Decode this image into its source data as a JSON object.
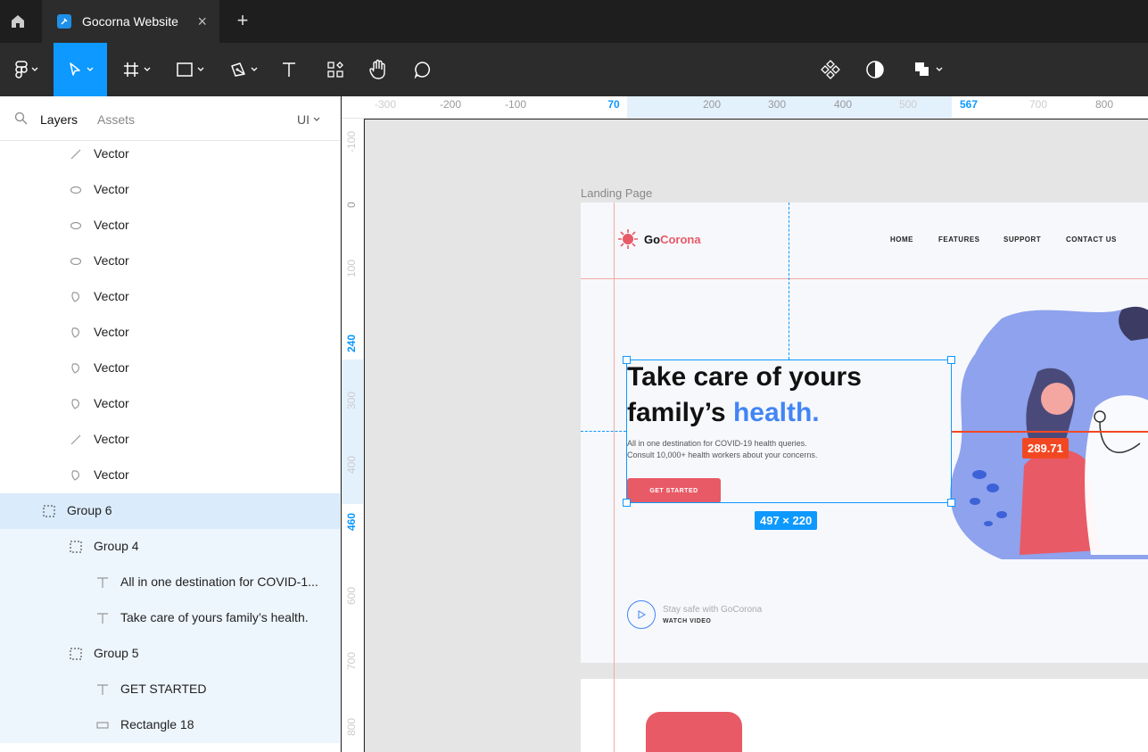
{
  "app": {
    "tab_title": "Gocorna Website"
  },
  "toolbar": {
    "tools": [
      "figma-menu",
      "move",
      "frame",
      "shape",
      "pen",
      "text",
      "resources",
      "hand",
      "comment"
    ],
    "right_tools": [
      "components",
      "mask",
      "boolean"
    ]
  },
  "panel": {
    "tab_layers": "Layers",
    "tab_assets": "Assets",
    "page_label": "UI"
  },
  "layers": [
    {
      "name": "Vector",
      "type": "vector-line"
    },
    {
      "name": "Vector",
      "type": "vector-ellipse"
    },
    {
      "name": "Vector",
      "type": "vector-ellipse"
    },
    {
      "name": "Vector",
      "type": "vector-ellipse"
    },
    {
      "name": "Vector",
      "type": "vector-shape"
    },
    {
      "name": "Vector",
      "type": "vector-shape"
    },
    {
      "name": "Vector",
      "type": "vector-shape"
    },
    {
      "name": "Vector",
      "type": "vector-shape"
    },
    {
      "name": "Vector",
      "type": "vector-line"
    },
    {
      "name": "Vector",
      "type": "vector-shape"
    },
    {
      "name": "Group 6",
      "type": "group"
    },
    {
      "name": "Group 4",
      "type": "group"
    },
    {
      "name": "All in one destination for COVID-1...",
      "type": "text"
    },
    {
      "name": "Take care of yours family’s health.",
      "type": "text"
    },
    {
      "name": "Group 5",
      "type": "group"
    },
    {
      "name": "GET STARTED",
      "type": "text"
    },
    {
      "name": "Rectangle 18",
      "type": "rectangle"
    }
  ],
  "rulers": {
    "h_marks": [
      "-300",
      "-200",
      "-100",
      "70",
      "200",
      "300",
      "400",
      "500",
      "567",
      "700",
      "800"
    ],
    "v_marks": [
      "-100",
      "0",
      "100",
      "240",
      "300",
      "400",
      "460",
      "600",
      "700",
      "800"
    ]
  },
  "canvas": {
    "frame_label": "Landing Page",
    "logo_go": "Go",
    "logo_corona": "Corona",
    "nav": [
      "HOME",
      "FEATURES",
      "SUPPORT",
      "CONTACT US"
    ],
    "hero_title_1": "Take care of yours",
    "hero_title_2": "family’s ",
    "hero_title_accent": "health.",
    "hero_sub_1": "All in one destination for COVID-19 health queries.",
    "hero_sub_2": "Consult 10,000+ health workers about your concerns.",
    "cta": "GET STARTED",
    "stay_safe": "Stay safe with GoCorona",
    "watch_video": "WATCH VIDEO",
    "selection_size": "497 × 220",
    "measure_value": "289.71"
  },
  "colors": {
    "accent": "#0d99ff",
    "brand_red": "#e85a66",
    "brand_blue": "#4285f4",
    "measure": "#f24822"
  }
}
